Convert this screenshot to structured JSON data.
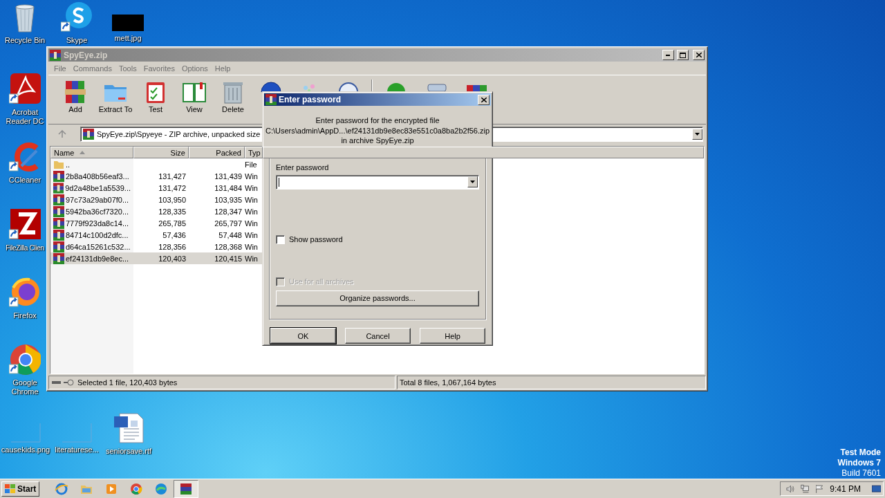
{
  "desktop_icons": [
    {
      "label": "Recycle Bin",
      "kind": "recycle"
    },
    {
      "label": "Skype",
      "kind": "skype"
    },
    {
      "label": "mett.jpg",
      "kind": "hidden_image"
    },
    {
      "label": "Acrobat Reader DC",
      "kind": "acrobat"
    },
    {
      "label": "CCleaner",
      "kind": "ccleaner"
    },
    {
      "label": "FileZilla Clien",
      "kind": "filezilla"
    },
    {
      "label": "Firefox",
      "kind": "firefox"
    },
    {
      "label": "Google Chrome",
      "kind": "chrome"
    },
    {
      "label": "causekids.png",
      "kind": "blank_image"
    },
    {
      "label": "literaturese...",
      "kind": "blank_image"
    },
    {
      "label": "seniorsave.rtf",
      "kind": "word"
    }
  ],
  "window": {
    "title": "SpyEye.zip",
    "menu": [
      "File",
      "Commands",
      "Tools",
      "Favorites",
      "Options",
      "Help"
    ],
    "toolbar": [
      {
        "label": "Add",
        "kind": "add"
      },
      {
        "label": "Extract To",
        "kind": "extract"
      },
      {
        "label": "Test",
        "kind": "test"
      },
      {
        "label": "View",
        "kind": "view"
      },
      {
        "label": "Delete",
        "kind": "delete"
      },
      {
        "kind": "find"
      },
      {
        "kind": "wizard"
      },
      {
        "kind": "info"
      },
      {
        "kind": "scan"
      },
      {
        "kind": "comment"
      },
      {
        "kind": "sfx"
      }
    ],
    "address": "SpyEye.zip\\Spyeye - ZIP archive, unpacked size",
    "columns": [
      {
        "label": "Name",
        "sorted": true
      },
      {
        "label": "Size",
        "sorted": false
      },
      {
        "label": "Packed",
        "sorted": false
      },
      {
        "label": "Typ",
        "sorted": false
      }
    ],
    "rows": [
      {
        "name": "..",
        "size": "",
        "packed": "",
        "type": "File",
        "kind": "folder",
        "selected": false
      },
      {
        "name": "2b8a408b56eaf3...",
        "size": "131,427",
        "packed": "131,439",
        "type": "Win",
        "kind": "archive",
        "selected": false
      },
      {
        "name": "9d2a48be1a5539...",
        "size": "131,472",
        "packed": "131,484",
        "type": "Win",
        "kind": "archive",
        "selected": false
      },
      {
        "name": "97c73a29ab07f0...",
        "size": "103,950",
        "packed": "103,935",
        "type": "Win",
        "kind": "archive",
        "selected": false
      },
      {
        "name": "5942ba36cf7320...",
        "size": "128,335",
        "packed": "128,347",
        "type": "Win",
        "kind": "archive",
        "selected": false
      },
      {
        "name": "7779f923da8c14...",
        "size": "265,785",
        "packed": "265,797",
        "type": "Win",
        "kind": "archive",
        "selected": false
      },
      {
        "name": "84714c100d2dfc...",
        "size": "57,436",
        "packed": "57,448",
        "type": "Win",
        "kind": "archive",
        "selected": false
      },
      {
        "name": "d64ca15261c532...",
        "size": "128,356",
        "packed": "128,368",
        "type": "Win",
        "kind": "archive",
        "selected": false
      },
      {
        "name": "ef24131db9e8ec...",
        "size": "120,403",
        "packed": "120,415",
        "type": "Win",
        "kind": "archive",
        "selected": true
      }
    ],
    "status_left": "Selected 1 file, 120,403 bytes",
    "status_right": "Total 8 files, 1,067,164 bytes"
  },
  "dialog": {
    "title": "Enter password",
    "message": [
      "Enter password for the encrypted file",
      "C:\\Users\\admin\\AppD...\\ef24131db9e8ec83e551c0a8ba2b2f56.zip",
      "in archive SpyEye.zip"
    ],
    "field_label": "Enter password",
    "checkboxes": [
      {
        "label": "Show password",
        "checked": false,
        "disabled": false
      },
      {
        "label": "Use for all archives",
        "checked": false,
        "disabled": true
      }
    ],
    "organize_button": "Organize passwords...",
    "buttons": [
      {
        "label": "OK",
        "default": true
      },
      {
        "label": "Cancel",
        "default": false
      },
      {
        "label": "Help",
        "default": false
      }
    ]
  },
  "system_info": [
    "Test Mode",
    "Windows 7",
    "Build 7601"
  ],
  "taskbar": {
    "start": "Start",
    "apps": [
      {
        "kind": "ie",
        "active": false
      },
      {
        "kind": "explorer",
        "active": false
      },
      {
        "kind": "media",
        "active": false
      },
      {
        "kind": "chrome",
        "active": false
      },
      {
        "kind": "edge",
        "active": false
      },
      {
        "kind": "winrar",
        "active": true
      }
    ],
    "clock": "9:41 PM"
  }
}
